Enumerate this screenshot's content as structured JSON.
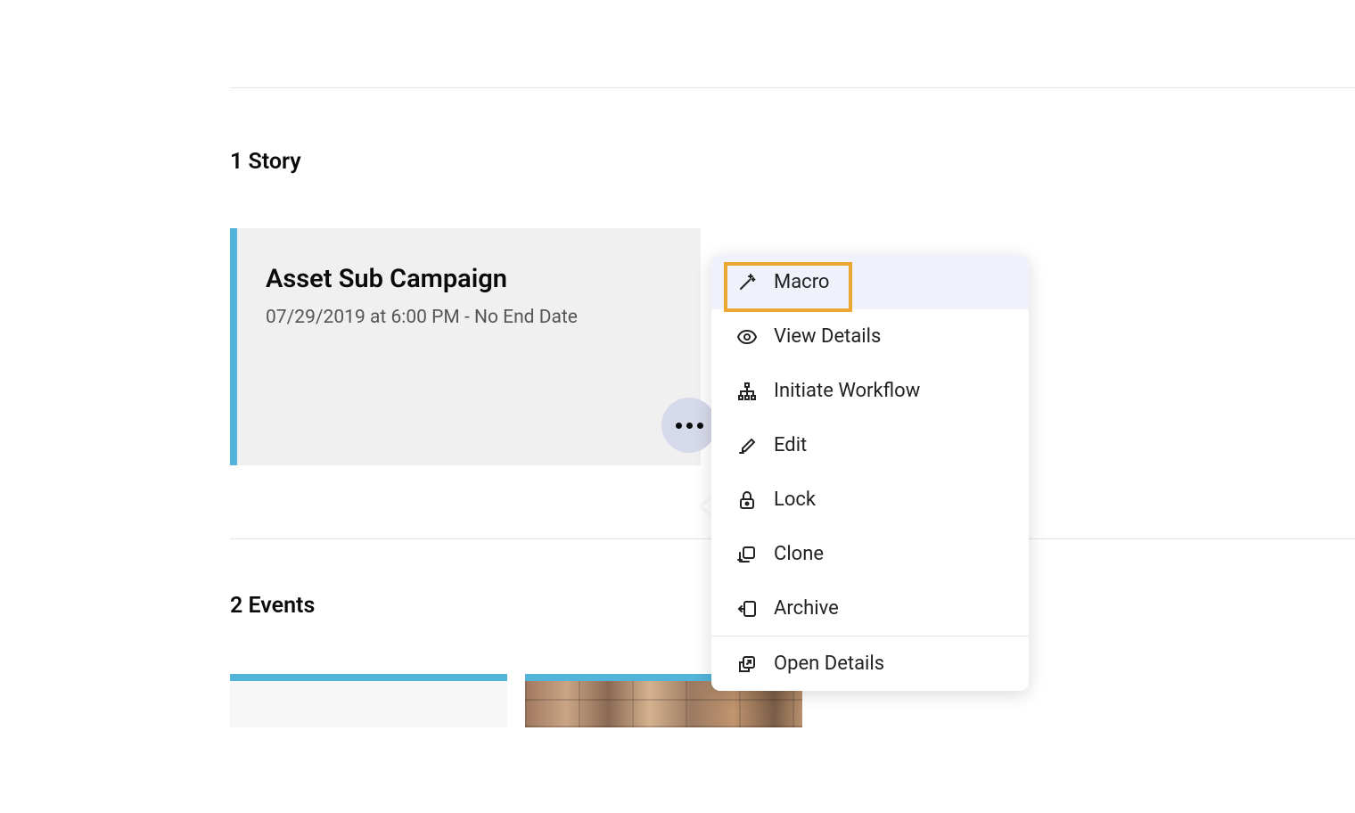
{
  "sections": {
    "story": {
      "title": "1 Story"
    },
    "events": {
      "title": "2 Events"
    }
  },
  "story_card": {
    "title": "Asset Sub Campaign",
    "subtitle": "07/29/2019 at 6:00 PM - No End Date"
  },
  "context_menu": {
    "items": [
      {
        "label": "Macro",
        "icon": "wand",
        "highlighted": true
      },
      {
        "label": "View Details",
        "icon": "eye",
        "highlighted": false
      },
      {
        "label": "Initiate Workflow",
        "icon": "workflow",
        "highlighted": false
      },
      {
        "label": "Edit",
        "icon": "pencil",
        "highlighted": false
      },
      {
        "label": "Lock",
        "icon": "lock",
        "highlighted": false
      },
      {
        "label": "Clone",
        "icon": "clone",
        "highlighted": false
      },
      {
        "label": "Archive",
        "icon": "archive",
        "highlighted": false
      },
      {
        "label": "Open Details",
        "icon": "open-external",
        "highlighted": false,
        "separated": true
      }
    ]
  }
}
